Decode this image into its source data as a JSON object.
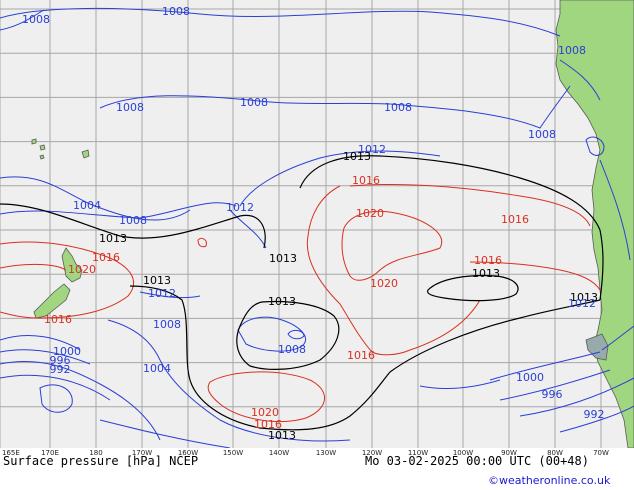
{
  "product": "Surface pressure [hPa] NCEP",
  "valid_time": "Mo 03-02-2025 00:00 UTC (00+48)",
  "credit": "©weatheronline.co.uk",
  "longitude_labels": [
    "165E",
    "170E",
    "180",
    "170W",
    "160W",
    "150W",
    "140W",
    "130W",
    "120W",
    "110W",
    "100W",
    "90W",
    "80W",
    "70W"
  ],
  "colors": {
    "ocean": "#efefef",
    "land": "#9fd67f",
    "coast": "#5a5a5a",
    "grid": "#a7a7a7",
    "low_isobar": "#2a3fd6",
    "high_isobar": "#d93020",
    "ref_isobar": "#000000",
    "credit": "#1a1ad0"
  },
  "isobar_labels": [
    {
      "text": "1008",
      "kind": "low"
    },
    {
      "text": "1008",
      "kind": "low"
    },
    {
      "text": "1008",
      "kind": "low"
    },
    {
      "text": "1008",
      "kind": "low"
    },
    {
      "text": "1008",
      "kind": "low"
    },
    {
      "text": "1008",
      "kind": "low"
    },
    {
      "text": "1008",
      "kind": "low"
    },
    {
      "text": "1004",
      "kind": "low"
    },
    {
      "text": "1008",
      "kind": "low"
    },
    {
      "text": "1012",
      "kind": "low"
    },
    {
      "text": "1012",
      "kind": "low"
    },
    {
      "text": "1013",
      "kind": "ref"
    },
    {
      "text": "1016",
      "kind": "high"
    },
    {
      "text": "1020",
      "kind": "high"
    },
    {
      "text": "1016",
      "kind": "high"
    },
    {
      "text": "1013",
      "kind": "ref"
    },
    {
      "text": "1016",
      "kind": "high"
    },
    {
      "text": "1020",
      "kind": "high"
    },
    {
      "text": "1013",
      "kind": "ref"
    },
    {
      "text": "1012",
      "kind": "low"
    },
    {
      "text": "1013",
      "kind": "ref"
    },
    {
      "text": "1020",
      "kind": "high"
    },
    {
      "text": "1016",
      "kind": "high"
    },
    {
      "text": "1013",
      "kind": "ref"
    },
    {
      "text": "1013",
      "kind": "ref"
    },
    {
      "text": "1012",
      "kind": "low"
    },
    {
      "text": "1016",
      "kind": "high"
    },
    {
      "text": "1008",
      "kind": "low"
    },
    {
      "text": "1013",
      "kind": "ref"
    },
    {
      "text": "1008",
      "kind": "low"
    },
    {
      "text": "1016",
      "kind": "high"
    },
    {
      "text": "1000",
      "kind": "low"
    },
    {
      "text": "996",
      "kind": "low"
    },
    {
      "text": "992",
      "kind": "low"
    },
    {
      "text": "1004",
      "kind": "low"
    },
    {
      "text": "1020",
      "kind": "high"
    },
    {
      "text": "1016",
      "kind": "high"
    },
    {
      "text": "1013",
      "kind": "ref"
    },
    {
      "text": "1000",
      "kind": "low"
    },
    {
      "text": "996",
      "kind": "low"
    },
    {
      "text": "992",
      "kind": "low"
    }
  ]
}
